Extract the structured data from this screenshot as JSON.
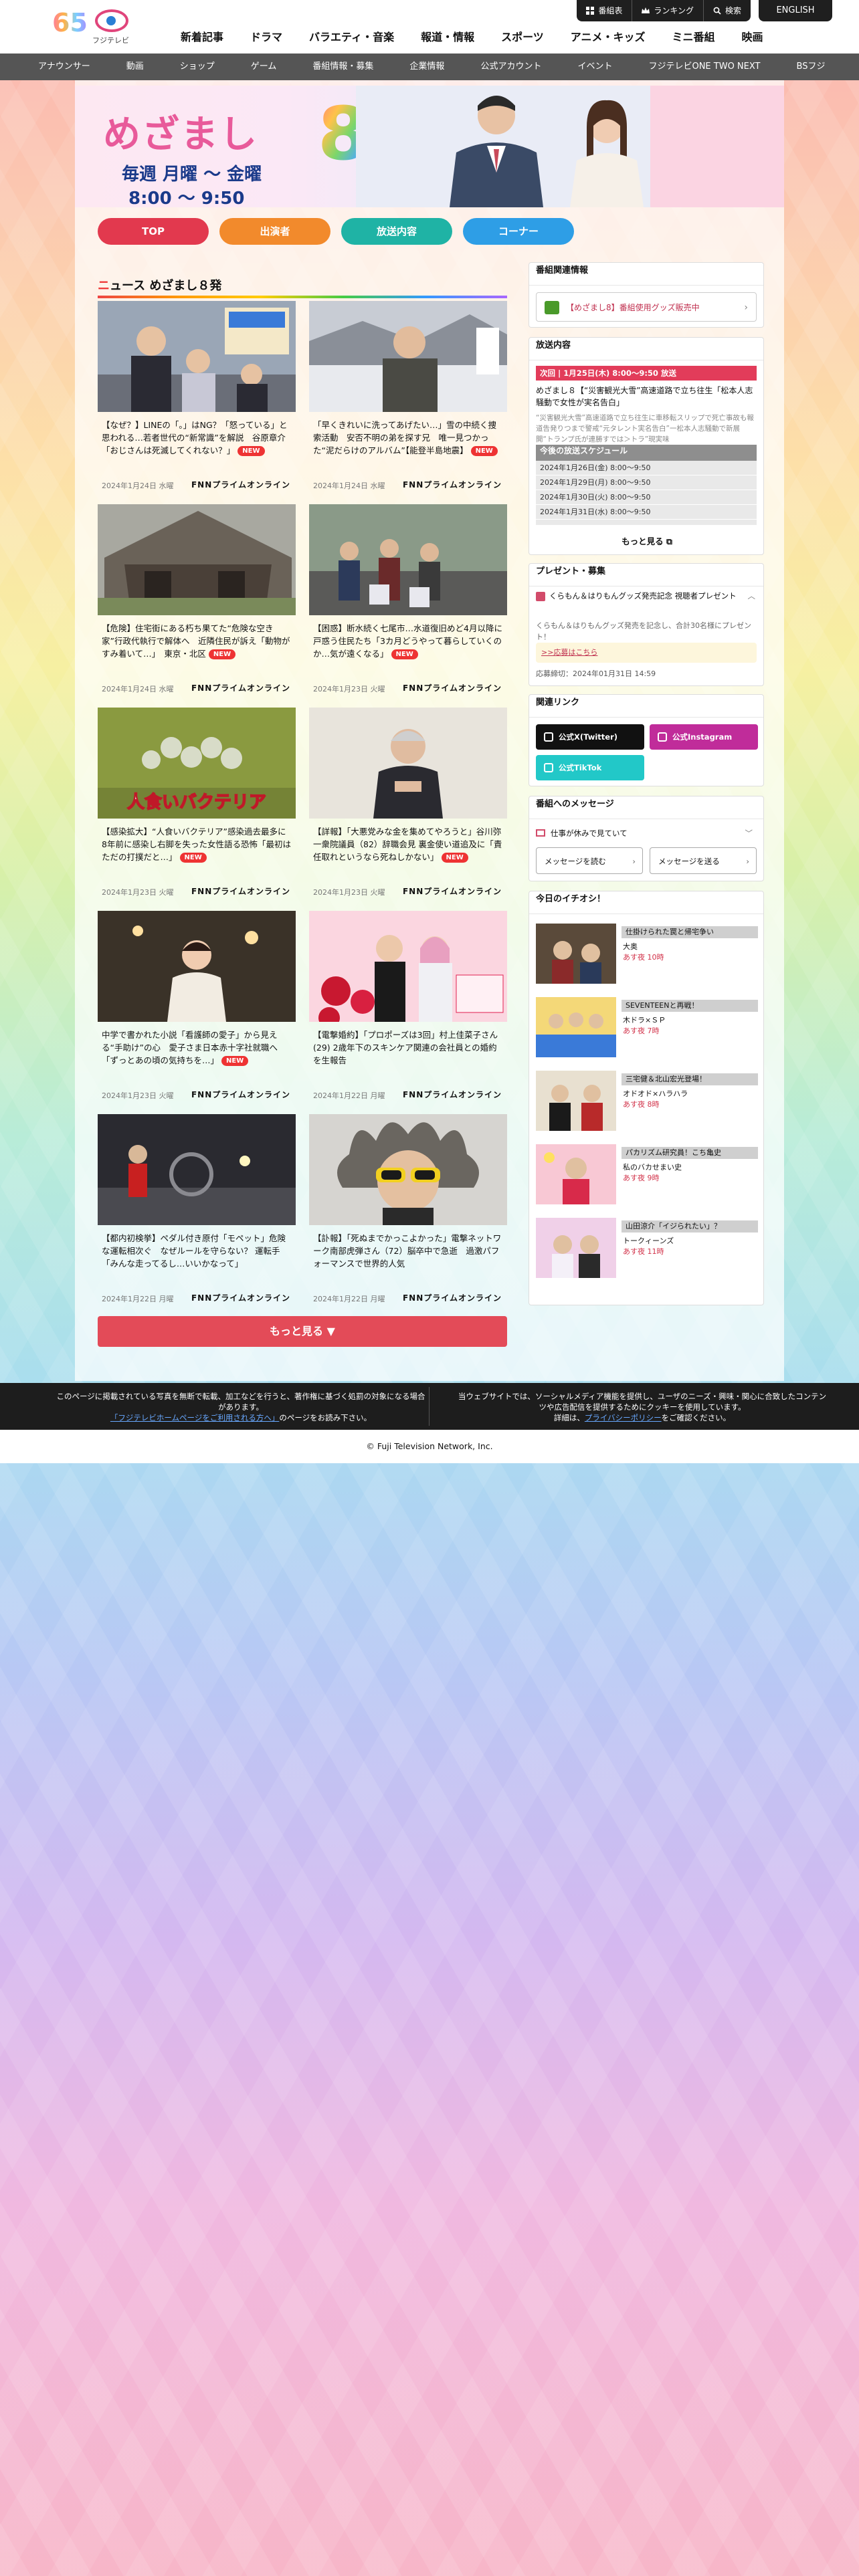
{
  "header": {
    "logo_num": "65",
    "logo_text": "フジテレビ",
    "util": [
      "番組表",
      "ランキング",
      "検索"
    ],
    "english": "ENGLISH",
    "nav": [
      "新着記事",
      "ドラマ",
      "バラエティ・音楽",
      "報道・情報",
      "スポーツ",
      "アニメ・キッズ",
      "ミニ番組",
      "映画"
    ]
  },
  "subnav": [
    "アナウンサー",
    "動画",
    "ショップ",
    "ゲーム",
    "番組情報・募集",
    "企業情報",
    "公式アカウント",
    "イベント",
    "フジテレビONE TWO NEXT",
    "BSフジ"
  ],
  "banner": {
    "title": "めざまし",
    "eight": "8",
    "days": "毎週 月曜 〜 金曜",
    "time": "8:00 〜 9:50"
  },
  "prog_nav": [
    {
      "label": "TOP",
      "color": "#e2394e"
    },
    {
      "label": "出演者",
      "color": "#f28a2c"
    },
    {
      "label": "放送内容",
      "color": "#1fb3a5"
    },
    {
      "label": "コーナー",
      "color": "#2e9ee6"
    }
  ],
  "news": {
    "title": "ニュース めざまし８発",
    "more": "もっと見る ▼",
    "items": [
      {
        "caption": "【なぜ？】LINEの「。」はNG？「怒っている」と思われる…若者世代の“新常識”を解説　谷原章介「おじさんは死滅してくれない？」",
        "new": "NEW",
        "date": "2024年1月24日 水曜",
        "source": "FNNプライムオンライン"
      },
      {
        "caption": "「早くきれいに洗ってあげたい…」雪の中続く捜索活動　安否不明の弟を探す兄　唯一見つかった“泥だらけのアルバム”【能登半島地震】",
        "new": "NEW",
        "date": "2024年1月24日 水曜",
        "source": "FNNプライムオンライン"
      },
      {
        "caption": "【危険】住宅街にある朽ち果てた“危険な空き家”行政代執行で解体へ　近隣住民が訴え「動物がすみ着いて…」　東京・北区",
        "new": "NEW",
        "date": "2024年1月24日 水曜",
        "source": "FNNプライムオンライン"
      },
      {
        "caption": "【困惑】断水続く七尾市…水道復旧めど4月以降に戸惑う住民たち「3カ月どうやって暮らしていくのか…気が遠くなる」",
        "new": "NEW",
        "date": "2024年1月23日 火曜",
        "source": "FNNプライムオンライン"
      },
      {
        "caption": "【感染拡大】“人食いバクテリア”感染過去最多に　8年前に感染し右脚を失った女性語る恐怖「最初はただの打撲だと…」",
        "new": "NEW",
        "date": "2024年1月23日 火曜",
        "source": "FNNプライムオンライン"
      },
      {
        "caption": "【詳報】「大悪党みな金を集めてやろうと」谷川弥一衆院議員（82）辞職会見 裏金使い道追及に「責任取れというなら死ねしかない」",
        "new": "NEW",
        "date": "2024年1月23日 火曜",
        "source": "FNNプライムオンライン"
      },
      {
        "caption": "中学で書かれた小説「看護師の愛子」から見える“手助け”の心　愛子さま日本赤十字社就職へ「ずっとあの頃の気持ちを…」",
        "new": "NEW",
        "date": "2024年1月23日 火曜",
        "source": "FNNプライムオンライン"
      },
      {
        "caption": "【電撃婚約】「プロポーズは3回」村上佳菜子さん(29) 2歳年下のスキンケア関連の会社員との婚約を生報告",
        "new": "",
        "date": "2024年1月22日 月曜",
        "source": "FNNプライムオンライン"
      },
      {
        "caption": "【都内初検挙】ペダル付き原付「モペット」危険な運転相次ぐ　なぜルールを守らない？ 運転手「みんな走ってるし…いいかなって」",
        "new": "",
        "date": "2024年1月22日 月曜",
        "source": "FNNプライムオンライン"
      },
      {
        "caption": "【訃報】「死ぬまでかっこよかった」電撃ネットワーク南部虎弾さん（72）脳卒中で急逝　過激パフォーマンスで世界的人気",
        "new": "",
        "date": "2024年1月22日 月曜",
        "source": "FNNプライムオンライン"
      }
    ]
  },
  "sidebar": {
    "related": {
      "title": "番組関連情報",
      "link": "【めざまし8】番組使用グッズ販売中"
    },
    "onair": {
      "title": "放送内容",
      "next_bar": "次回 | 1月25日(木) 8:00〜9:50 放送",
      "next_text": "めざまし８【“災害観光大雪”高速道路で立ち往生「松本人志騒動で女性が実名告白」",
      "next_desc": "“災害観光大雪”高速道路で立ち往生に車移転スリップで死亡事故も報道告発りつまで警戒“元タレント実名告白”一松本人志騒動で新展開“トランプ氏が連勝すでは＞トラ”現実味",
      "sched_title": "今後の放送スケジュール",
      "sched": [
        "2024年1月26日(金) 8:00〜9:50",
        "2024年1月29日(月) 8:00〜9:50",
        "2024年1月30日(火) 8:00〜9:50",
        "2024年1月31日(水) 8:00〜9:50"
      ],
      "more": "もっと見る"
    },
    "present": {
      "title": "プレゼント・募集",
      "row": "くらもん＆はりもんグッズ発売記念 視聴者プレゼント",
      "body": "くらもん＆はりもんグッズ発売を記念し、合計30名様にプレゼント！",
      "link": ">>応募はこちら",
      "date": "応募締切：2024年01月31日 14:59"
    },
    "links": {
      "title": "関連リンク",
      "x": "公式X(Twitter)",
      "ig": "公式Instagram",
      "tt": "公式TikTok"
    },
    "message": {
      "title": "番組へのメッセージ",
      "row": "仕事が休みで見ていて",
      "read": "メッセージを読む",
      "send": "メッセージを送る"
    },
    "picks": {
      "title": "今日のイチオシ！",
      "items": [
        {
          "title": "仕掛けられた罠と帰宅争い",
          "sub": "大奥",
          "time": "あす夜 10時"
        },
        {
          "title": "SEVENTEENと再戦！",
          "sub": "木ドラ×ＳＰ",
          "time": "あす夜 7時"
        },
        {
          "title": "三宅健＆北山宏光登場！",
          "sub": "オドオド×ハラハラ",
          "time": "あす夜 8時"
        },
        {
          "title": "パカリズム研究員！こち亀史",
          "sub": "私のバカせまい史",
          "time": "あす夜 9時"
        },
        {
          "title": "山田涼介「イジられたい」？",
          "sub": "トークィーンズ",
          "time": "あす夜 11時"
        }
      ]
    }
  },
  "footer": {
    "left": "このページに掲載されている写真を無断で転載、加工などを行うと、著作権に基づく処罰の対象になる場合があります。",
    "left_link": "「フジテレビホームページをご利用される方へ」",
    "left_tail": "のページをお読み下さい。",
    "right": "当ウェブサイトでは、ソーシャルメディア機能を提供し、ユーザのニーズ・興味・関心に合致したコンテンツや広告配信を提供するためにクッキーを使用しています。",
    "right_tail1": "詳細は、",
    "right_link": "プライバシーポリシー",
    "right_tail2": "をご確認ください。"
  },
  "copyright": "© Fuji Television Network, Inc."
}
